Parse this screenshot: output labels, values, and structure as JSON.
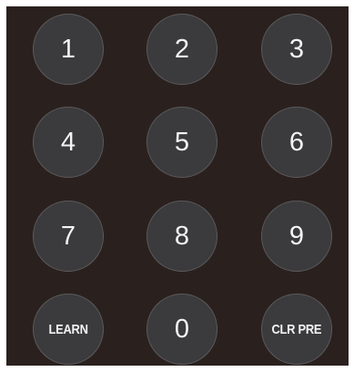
{
  "keypad": {
    "rows": [
      [
        "1",
        "2",
        "3"
      ],
      [
        "4",
        "5",
        "6"
      ],
      [
        "7",
        "8",
        "9"
      ],
      [
        "LEARN",
        "0",
        "CLR PRE"
      ]
    ]
  },
  "colors": {
    "panel_background": "#2a211f",
    "key_fill": "#3b3a3c",
    "key_border": "#5c5a5c",
    "key_text": "#f4f4f4"
  }
}
